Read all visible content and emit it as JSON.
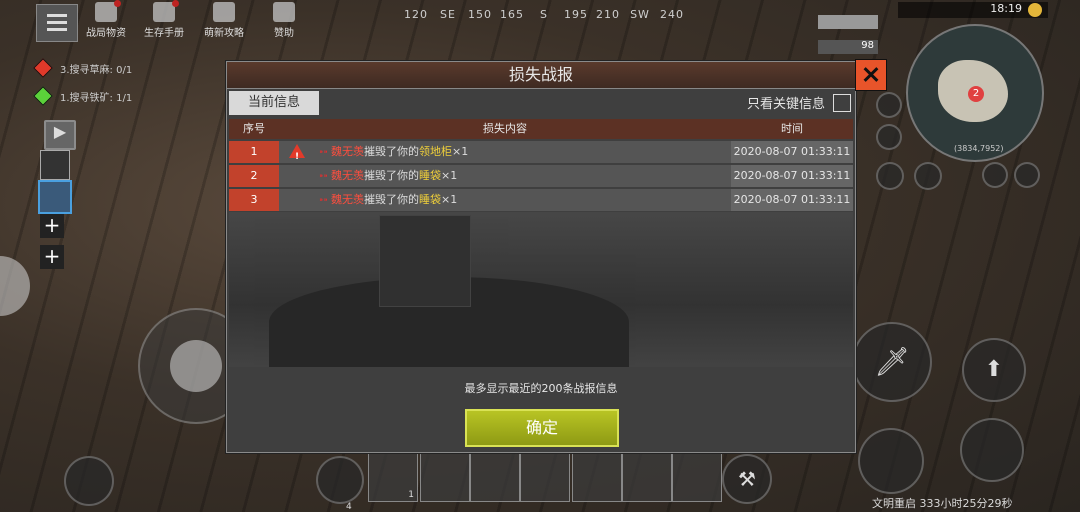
{
  "topbar": {
    "items": [
      {
        "label": "战局物资",
        "icon": "supplies-icon"
      },
      {
        "label": "生存手册",
        "icon": "handbook-icon"
      },
      {
        "label": "萌新攻略",
        "icon": "guide-icon"
      },
      {
        "label": "赞助",
        "icon": "sponsor-icon"
      }
    ],
    "compass": [
      "120",
      "SE",
      "150",
      "165",
      "S",
      "195",
      "210",
      "SW",
      "240"
    ]
  },
  "quests": [
    {
      "text": "3.搜寻草麻: 0/1",
      "color": "#e0392a"
    },
    {
      "text": "1.搜寻铁矿: 1/1",
      "color": "#5bd13a"
    }
  ],
  "status": {
    "clock": "18:19",
    "health_value": "98"
  },
  "minimap": {
    "marker_count": "2",
    "coords": "(3834,7952)"
  },
  "dialog": {
    "title": "损失战报",
    "tab_label": "当前信息",
    "filter_label": "只看关键信息",
    "columns": [
      "序号",
      "损失内容",
      "时间"
    ],
    "rows": [
      {
        "index": "1",
        "player": "魏无羡",
        "action": "摧毁了你的",
        "item": "领地柜",
        "qty": "×1",
        "time": "2020-08-07 01:33:11",
        "warning": true
      },
      {
        "index": "2",
        "player": "魏无羡",
        "action": "摧毁了你的",
        "item": "睡袋",
        "qty": "×1",
        "time": "2020-08-07 01:33:11",
        "warning": false
      },
      {
        "index": "3",
        "player": "魏无羡",
        "action": "摧毁了你的",
        "item": "睡袋",
        "qty": "×1",
        "time": "2020-08-07 01:33:11",
        "warning": false
      }
    ],
    "notice": "最多显示最近的200条战报信息",
    "confirm_label": "确定"
  },
  "hotbar": {
    "first_slot_count": "1",
    "slot_index": "4"
  },
  "bottom_timer": "文明重启 333小时25分29秒"
}
